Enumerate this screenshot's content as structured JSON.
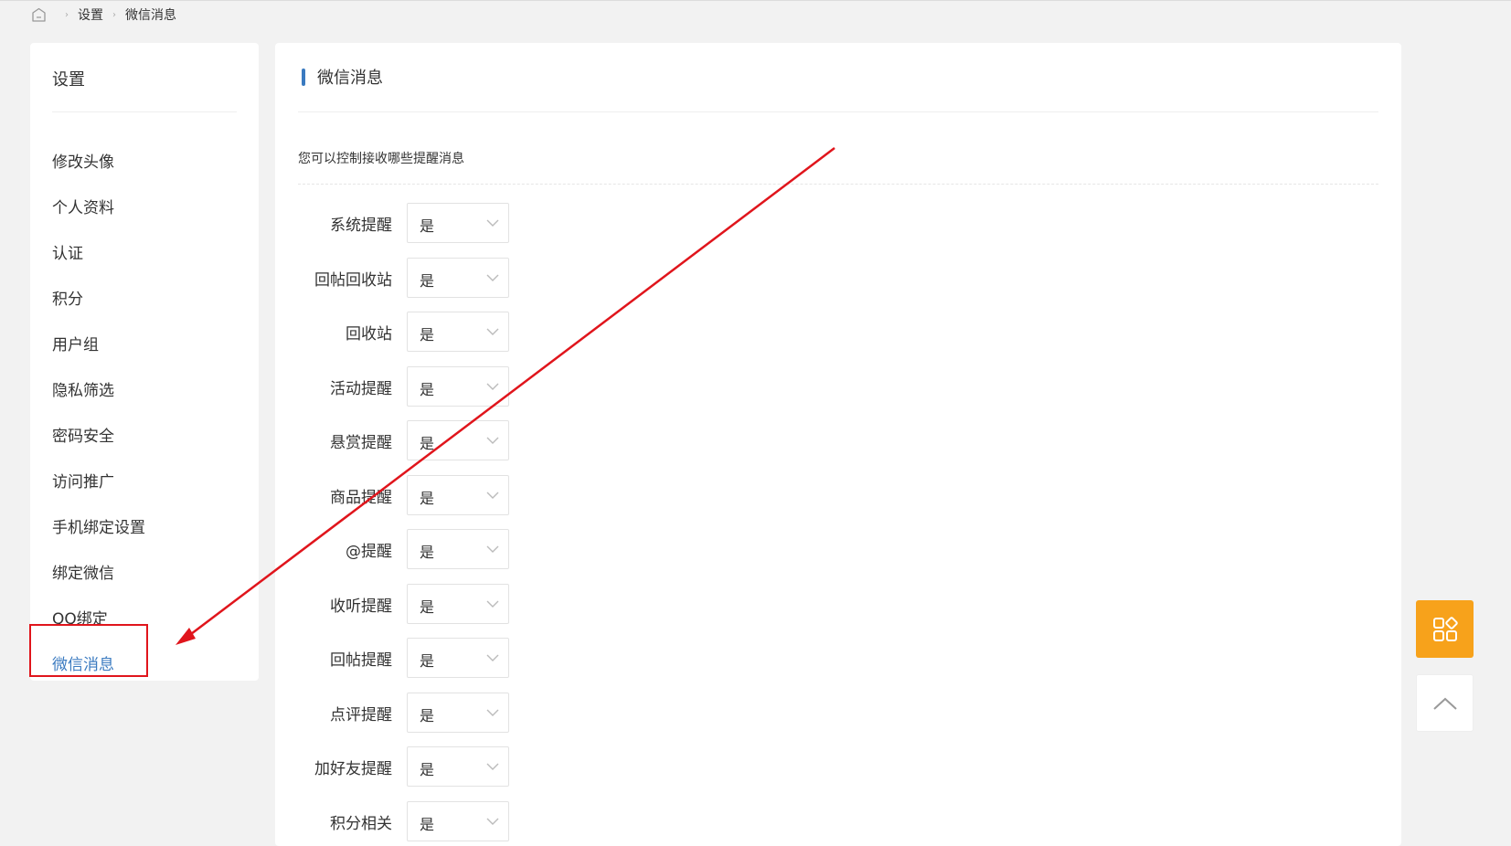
{
  "breadcrumb": {
    "home_icon": "home-icon",
    "items": [
      "设置",
      "微信消息"
    ]
  },
  "sidebar": {
    "title": "设置",
    "items": [
      {
        "label": "修改头像"
      },
      {
        "label": "个人资料"
      },
      {
        "label": "认证"
      },
      {
        "label": "积分"
      },
      {
        "label": "用户组"
      },
      {
        "label": "隐私筛选"
      },
      {
        "label": "密码安全"
      },
      {
        "label": "访问推广"
      },
      {
        "label": "手机绑定设置"
      },
      {
        "label": "绑定微信"
      },
      {
        "label": "QQ绑定"
      },
      {
        "label": "微信消息"
      }
    ],
    "active_index": 11
  },
  "main": {
    "title": "微信消息",
    "description": "您可以控制接收哪些提醒消息",
    "settings": [
      {
        "label": "系统提醒",
        "value": "是"
      },
      {
        "label": "回帖回收站",
        "value": "是"
      },
      {
        "label": "回收站",
        "value": "是"
      },
      {
        "label": "活动提醒",
        "value": "是"
      },
      {
        "label": "悬赏提醒",
        "value": "是"
      },
      {
        "label": "商品提醒",
        "value": "是"
      },
      {
        "label": "@提醒",
        "value": "是"
      },
      {
        "label": "收听提醒",
        "value": "是"
      },
      {
        "label": "回帖提醒",
        "value": "是"
      },
      {
        "label": "点评提醒",
        "value": "是"
      },
      {
        "label": "加好友提醒",
        "value": "是"
      },
      {
        "label": "积分相关",
        "value": "是"
      }
    ]
  },
  "floating": {
    "apps_icon": "apps-grid-icon",
    "top_icon": "chevron-up-icon"
  },
  "colors": {
    "accent": "#3a7ac0",
    "annotation": "#e0151c",
    "float_button": "#f7a21b"
  }
}
